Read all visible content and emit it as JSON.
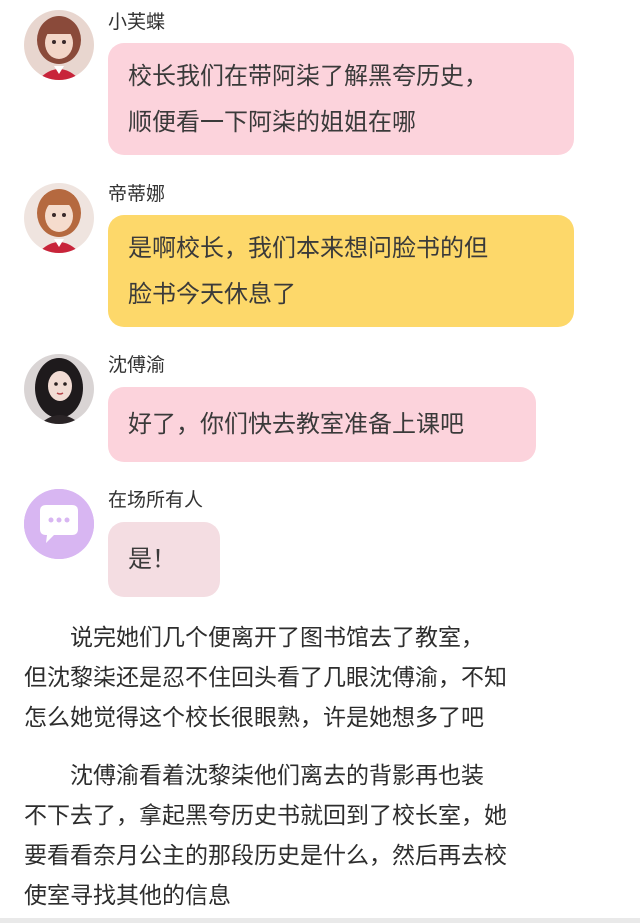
{
  "messages": [
    {
      "sender": "小芙蝶",
      "avatar": "avatar-girl-red-uniform",
      "bubble_color": "#fcd3dc",
      "lines": [
        "校长我们在带阿柒了解黑夸历史，",
        "顺便看一下阿柒的姐姐在哪"
      ]
    },
    {
      "sender": "帝蒂娜",
      "avatar": "avatar-girl-red-uniform-2",
      "bubble_color": "#fdd86a",
      "lines": [
        "是啊校长，我们本来想问脸书的但",
        "脸书今天休息了"
      ]
    },
    {
      "sender": "沈傅渝",
      "avatar": "avatar-dark-hair-woman",
      "bubble_color": "#fcd3dc",
      "lines": [
        "好了，你们快去教室准备上课吧"
      ]
    },
    {
      "sender": "在场所有人",
      "avatar": "chat-bubble-icon",
      "bubble_color": "#f4dde2",
      "lines": [
        "是！"
      ]
    }
  ],
  "narration": [
    {
      "lines": [
        "　　说完她们几个便离开了图书馆去了教室，",
        "但沈黎柒还是忍不住回头看了几眼沈傅渝，不知",
        "怎么她觉得这个校长很眼熟，许是她想多了吧"
      ]
    },
    {
      "lines": [
        "　　沈傅渝看着沈黎柒他们离去的背影再也装",
        "不下去了，拿起黑夸历史书就回到了校长室，她",
        "要看看奈月公主的那段历史是什么，然后再去校",
        "使室寻找其他的信息"
      ]
    }
  ]
}
